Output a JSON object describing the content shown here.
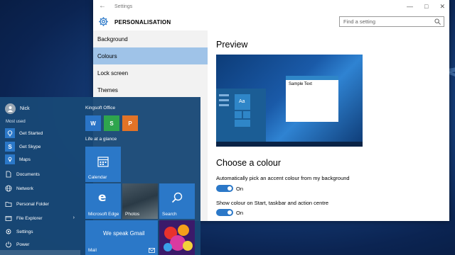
{
  "settings": {
    "window_title": "Settings",
    "section_title": "PERSONALISATION",
    "search_placeholder": "Find a setting",
    "nav": [
      "Background",
      "Colours",
      "Lock screen",
      "Themes"
    ],
    "selected_nav": "Colours",
    "preview_heading": "Preview",
    "preview_sample_text": "Sample Text",
    "preview_aa": "Aa",
    "choose_heading": "Choose a colour",
    "option1_label": "Automatically pick an accent colour from my background",
    "option1_state": "On",
    "option2_label": "Show colour on Start, taskbar and action centre",
    "option2_state": "On"
  },
  "start_menu": {
    "user_name": "Nick",
    "most_used_label": "Most used",
    "most_used": [
      {
        "label": "Get Started",
        "icon": "lightbulb-icon"
      },
      {
        "label": "Get Skype",
        "icon": "skype-icon"
      },
      {
        "label": "Maps",
        "icon": "maps-icon"
      }
    ],
    "system": [
      {
        "label": "Documents",
        "icon": "documents-icon"
      },
      {
        "label": "Network",
        "icon": "network-icon"
      },
      {
        "label": "Personal Folder",
        "icon": "folder-icon"
      },
      {
        "label": "File Explorer",
        "icon": "file-explorer-icon"
      },
      {
        "label": "Settings",
        "icon": "gear-icon"
      },
      {
        "label": "Power",
        "icon": "power-icon"
      }
    ],
    "group1": "Kingsoft Office",
    "group2": "Life at a glance",
    "tiles": {
      "calendar": "Calendar",
      "edge": "Microsoft Edge",
      "photos": "Photos",
      "search": "Search",
      "mail": "Mail",
      "mail_text": "We speak Gmail"
    },
    "kingsoft_letters": [
      "W",
      "S",
      "P"
    ]
  },
  "colors": {
    "accent": "#2b78c8",
    "nav_selected": "#9fc3e8",
    "start_bg": "#184876"
  }
}
